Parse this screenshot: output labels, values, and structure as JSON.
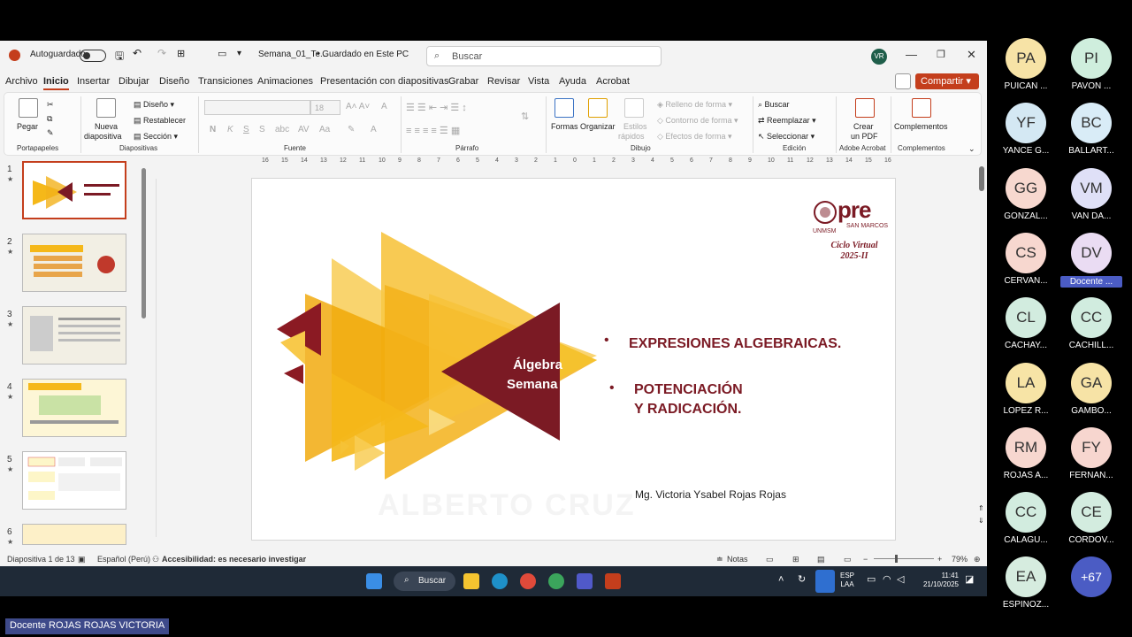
{
  "window": {
    "autosave_label": "Autoguardado",
    "doc_title": "Semana_01_Te...",
    "save_status": "• Guardado en Este PC",
    "search_placeholder": "Buscar",
    "user_initials": "VR"
  },
  "menu": [
    "Archivo",
    "Inicio",
    "Insertar",
    "Dibujar",
    "Diseño",
    "Transiciones",
    "Animaciones",
    "Presentación con diapositivas",
    "Grabar",
    "Revisar",
    "Vista",
    "Ayuda",
    "Acrobat"
  ],
  "share_label": "Compartir",
  "ribbon": {
    "paste": "Pegar",
    "portapapeles": "Portapapeles",
    "nueva": "Nueva",
    "diapositiva": "diapositiva",
    "diseno": "Diseño",
    "restablecer": "Restablecer",
    "seccion": "Sección",
    "diapositivas": "Diapositivas",
    "font_size": "18",
    "fuente": "Fuente",
    "parrafo": "Párrafo",
    "formas": "Formas",
    "organizar": "Organizar",
    "estilos": "Estilos",
    "rapidos": "rápidos",
    "relleno": "Relleno de forma",
    "contorno": "Contorno de forma",
    "efectos": "Efectos de forma",
    "dibujo": "Dibujo",
    "buscar": "Buscar",
    "reemplazar": "Reemplazar",
    "seleccionar": "Seleccionar",
    "edicion": "Edición",
    "crear": "Crear",
    "unpdf": "un PDF",
    "adobe": "Adobe Acrobat",
    "complementos": "Complementos",
    "complementos_label": "Complementos"
  },
  "ruler_ticks": [
    "16",
    "15",
    "14",
    "13",
    "12",
    "11",
    "10",
    "9",
    "8",
    "7",
    "6",
    "5",
    "4",
    "3",
    "2",
    "1",
    "0",
    "1",
    "2",
    "3",
    "4",
    "5",
    "6",
    "7",
    "8",
    "9",
    "10",
    "11",
    "12",
    "13",
    "14",
    "15",
    "16"
  ],
  "thumbnails": [
    {
      "num": "1",
      "title": "EXPRESIONES ALGEBRAICAS."
    },
    {
      "num": "2",
      "title": "CONTENIDO SEMANA 01"
    },
    {
      "num": "3",
      "title": ""
    },
    {
      "num": "4",
      "title": "POTENCIACIÓN EN R"
    },
    {
      "num": "5",
      "title": ""
    },
    {
      "num": "6",
      "title": ""
    }
  ],
  "slide": {
    "title_line1": "Álgebra",
    "title_line2": "Semana 1",
    "bullet1": "EXPRESIONES ALGEBRAICAS.",
    "bullet2_line1": "POTENCIACIÓN",
    "bullet2_line2": "Y RADICACIÓN.",
    "author": "Mg. Victoria Ysabel Rojas Rojas",
    "logo": "pre",
    "logo_sub": "SAN MARCOS",
    "unmsm": "UNMSM",
    "ciclo_line1": "Ciclo Virtual",
    "ciclo_line2": "2025-II",
    "watermark": "ALBERTO CRUZ"
  },
  "status": {
    "slide_info": "Diapositiva 1 de 13",
    "language": "Español (Perú)",
    "accessibility": "Accesibilidad: es necesario investigar",
    "notes": "Notas",
    "zoom": "79%"
  },
  "taskbar": {
    "search": "Buscar",
    "lang1": "ESP",
    "lang2": "LAA",
    "time": "11:41",
    "date": "21/10/2025"
  },
  "participants": [
    {
      "initials": "PA",
      "name": "PUICAN ...",
      "color": "#f7e3a6"
    },
    {
      "initials": "PI",
      "name": "PAVON ...",
      "color": "#cfeedd"
    },
    {
      "initials": "YF",
      "name": "YANCE G...",
      "color": "#d4e8f3"
    },
    {
      "initials": "BC",
      "name": "BALLART...",
      "color": "#d9ecf7"
    },
    {
      "initials": "GG",
      "name": "GONZAL...",
      "color": "#f7d8cf"
    },
    {
      "initials": "VM",
      "name": "VAN DA...",
      "color": "#dfe0f7"
    },
    {
      "initials": "CS",
      "name": "CERVAN...",
      "color": "#f7d7cf"
    },
    {
      "initials": "DV",
      "name": "Docente ...",
      "color": "#eadcf3"
    },
    {
      "initials": "CL",
      "name": "CACHAY...",
      "color": "#d2ecdf"
    },
    {
      "initials": "CC",
      "name": "CACHILL...",
      "color": "#d1ecdf"
    },
    {
      "initials": "LA",
      "name": "LOPEZ R...",
      "color": "#f7e4a6"
    },
    {
      "initials": "GA",
      "name": "GAMBO...",
      "color": "#f7e3a6"
    },
    {
      "initials": "RM",
      "name": "ROJAS A...",
      "color": "#f7d7cf"
    },
    {
      "initials": "FY",
      "name": "FERNAN...",
      "color": "#f7d6cf"
    },
    {
      "initials": "CC",
      "name": "CALAGU...",
      "color": "#d2ecdf"
    },
    {
      "initials": "CE",
      "name": "CORDOV...",
      "color": "#d3ecdf"
    },
    {
      "initials": "EA",
      "name": "ESPINOZ...",
      "color": "#d6ecdf"
    },
    {
      "initials": "+67",
      "name": "",
      "color": "#4b5cc4"
    }
  ],
  "presenter": "Docente ROJAS ROJAS VICTORIA"
}
